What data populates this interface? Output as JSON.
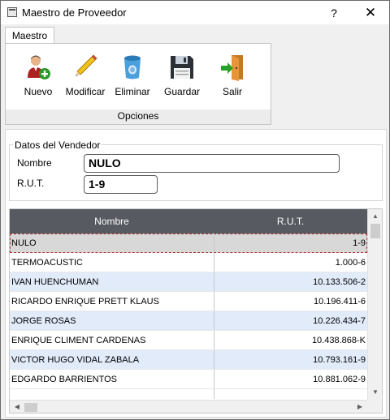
{
  "window": {
    "title": "Maestro de Proveedor",
    "help_glyph": "?",
    "close_glyph": "✕"
  },
  "ribbon": {
    "tab_label": "Maestro",
    "group_label": "Opciones",
    "buttons": [
      {
        "label": "Nuevo",
        "icon": "add-user-icon"
      },
      {
        "label": "Modificar",
        "icon": "pencil-icon"
      },
      {
        "label": "Eliminar",
        "icon": "trash-icon"
      },
      {
        "label": "Guardar",
        "icon": "floppy-disk-icon"
      },
      {
        "label": "Salir",
        "icon": "exit-door-icon"
      }
    ]
  },
  "form": {
    "legend": "Datos del Vendedor",
    "nombre_label": "Nombre",
    "nombre_value": "NULO",
    "rut_label": "R.U.T.",
    "rut_value": "1-9"
  },
  "grid": {
    "columns": [
      "Nombre",
      "R.U.T."
    ],
    "rows": [
      {
        "nombre": "NULO",
        "rut": "1-9"
      },
      {
        "nombre": "TERMOACUSTIC",
        "rut": "1.000-6"
      },
      {
        "nombre": "IVAN HUENCHUMAN",
        "rut": "10.133.506-2"
      },
      {
        "nombre": "RICARDO ENRIQUE PRETT KLAUS",
        "rut": "10.196.411-6"
      },
      {
        "nombre": "JORGE ROSAS",
        "rut": "10.226.434-7"
      },
      {
        "nombre": "ENRIQUE CLIMENT CARDENAS",
        "rut": "10.438.868-K"
      },
      {
        "nombre": "VICTOR HUGO VIDAL ZABALA",
        "rut": "10.793.161-9"
      },
      {
        "nombre": "EDGARDO BARRIENTOS",
        "rut": "10.881.062-9"
      }
    ],
    "selected_row": 0
  },
  "colors": {
    "header_bg": "#575a61",
    "alt_row": "#e2ebfa",
    "selected_row": "#d8d8d8"
  }
}
